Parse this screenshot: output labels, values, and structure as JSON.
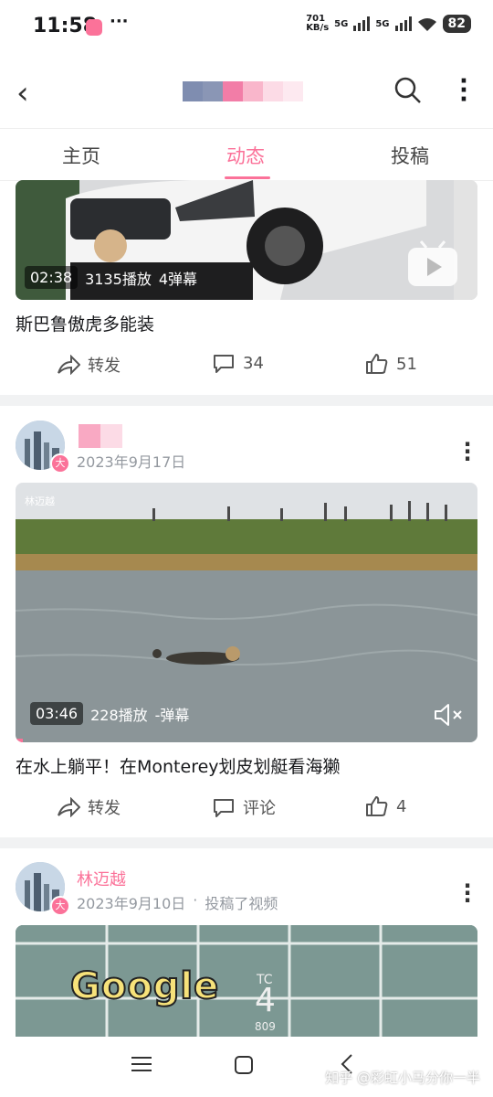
{
  "status_bar": {
    "time": "11:58",
    "overflow": "···",
    "net_speed_top": "701",
    "net_speed_bottom": "KB/s",
    "net1": "5G",
    "net2": "5G",
    "battery": "82"
  },
  "top_bar": {
    "back_icon": "back-arrow-icon",
    "search_icon": "search-icon",
    "more_icon": "more-vertical-icon"
  },
  "tabs": [
    {
      "label": "主页"
    },
    {
      "label": "动态",
      "active": true
    },
    {
      "label": "投稿"
    }
  ],
  "posts": [
    {
      "duration": "02:38",
      "plays": "3135播放",
      "danmaku": "4弹幕",
      "caption": "斯巴鲁傲虎多能装",
      "share_label": "转发",
      "comments": "34",
      "likes": "51"
    },
    {
      "date": "2023年9月17日",
      "watermark": "林迈越",
      "duration": "03:46",
      "plays": "228播放",
      "danmaku": "-弹幕",
      "caption": "在水上躺平！在Monterey划皮划艇看海獭",
      "share_label": "转发",
      "comments": "评论",
      "likes": "4"
    },
    {
      "username": "林迈越",
      "date": "2023年9月10日",
      "sep": "·",
      "action": "投稿了视频",
      "thumb_text": "Google",
      "thumb_small": "TC",
      "thumb_num": "4",
      "thumb_num2": "809"
    }
  ],
  "badge_text": "大",
  "bottom_watermark": "知乎 @彩虹小马分你一半",
  "colors": {
    "accent": "#fb7299",
    "text": "#18191c",
    "muted": "#9499a0"
  }
}
